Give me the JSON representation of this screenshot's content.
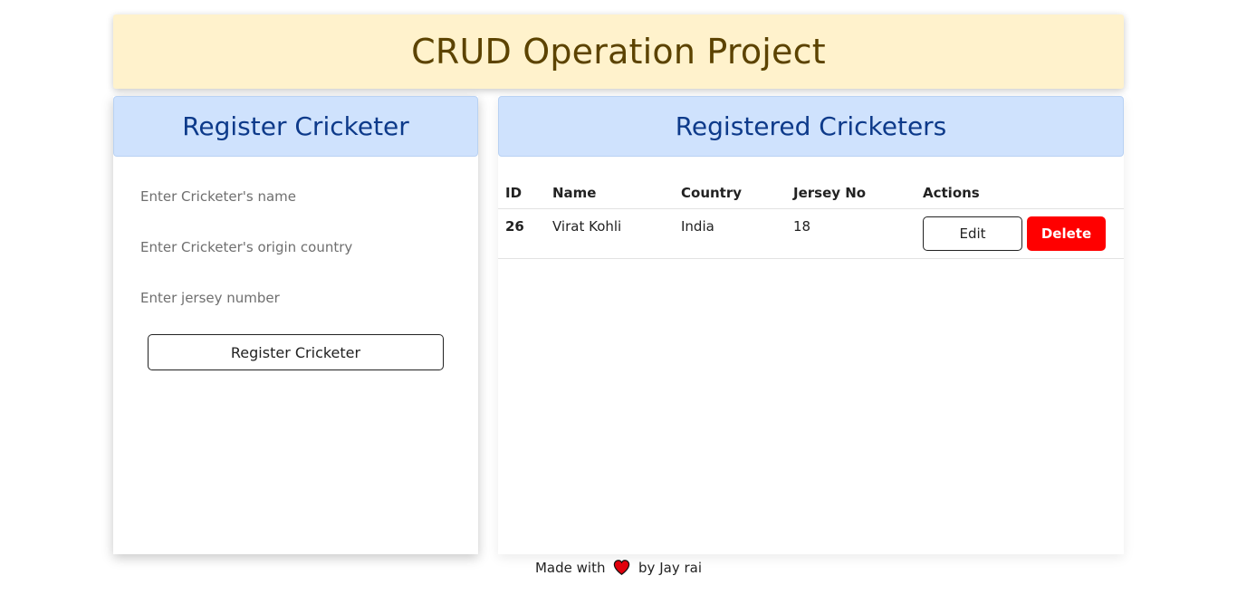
{
  "header": {
    "title": "CRUD Operation Project"
  },
  "register_panel": {
    "title": "Register Cricketer",
    "name_placeholder": "Enter Cricketer's name",
    "country_placeholder": "Enter Cricketer's origin country",
    "jersey_placeholder": "Enter jersey number",
    "submit_label": "Register Cricketer"
  },
  "list_panel": {
    "title": "Registered Cricketers",
    "columns": [
      "ID",
      "Name",
      "Country",
      "Jersey No",
      "Actions"
    ],
    "rows": [
      {
        "id": "26",
        "name": "Virat Kohli",
        "country": "India",
        "jersey": "18",
        "edit_label": "Edit",
        "delete_label": "Delete"
      }
    ]
  },
  "footer": {
    "prefix": "Made with",
    "suffix": "by Jay rai",
    "icon": "heart-icon"
  },
  "colors": {
    "header_bg": "#fff2cc",
    "header_text": "#5c4300",
    "panel_head_bg": "#cfe2fd",
    "panel_head_text": "#0d3a8a",
    "delete_bg": "#ff0000",
    "heart": "#e0000b"
  }
}
